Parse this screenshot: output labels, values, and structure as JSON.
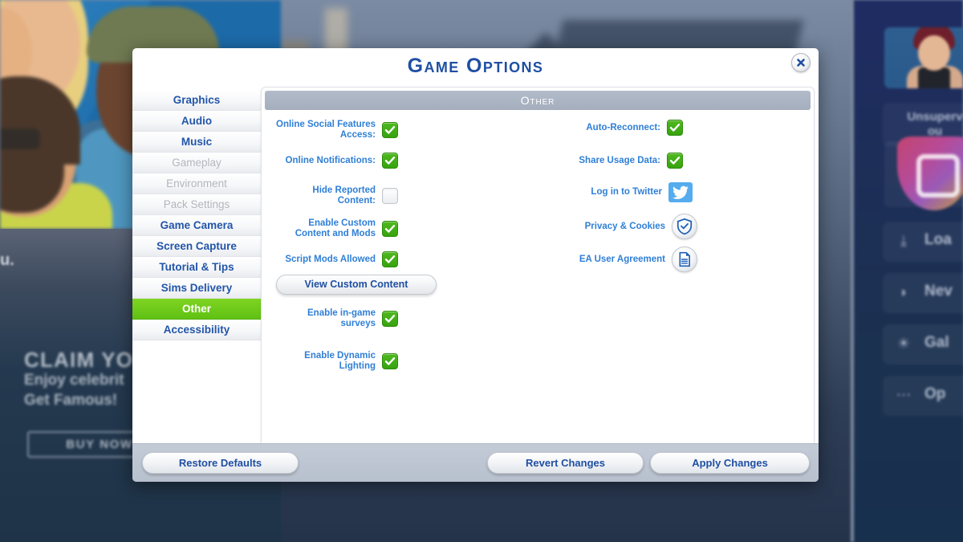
{
  "background": {
    "promo": {
      "ellipsis_text": "u.",
      "title": "CLAIM YO",
      "subtitle_line1": "Enjoy celebrit",
      "subtitle_line2": "Get Famous!",
      "buy_button": "BUY NOW"
    },
    "right_panel": {
      "status_line1": "Unsuperv",
      "status_line2": "ou",
      "items": [
        {
          "label": "Loa",
          "icon": "download-icon",
          "glyph": "⤓"
        },
        {
          "label": "Nev",
          "icon": "droplet-icon",
          "glyph": "◗"
        },
        {
          "label": "Gal",
          "icon": "lightbulb-icon",
          "glyph": "☀"
        },
        {
          "label": "Op",
          "icon": "ellipsis-icon",
          "glyph": "⋯"
        }
      ]
    }
  },
  "dialog": {
    "title": "Game Options",
    "close_icon": "close-icon",
    "sidebar": [
      {
        "label": "Graphics",
        "state": "normal"
      },
      {
        "label": "Audio",
        "state": "normal"
      },
      {
        "label": "Music",
        "state": "normal"
      },
      {
        "label": "Gameplay",
        "state": "disabled"
      },
      {
        "label": "Environment",
        "state": "disabled"
      },
      {
        "label": "Pack Settings",
        "state": "disabled"
      },
      {
        "label": "Game Camera",
        "state": "normal"
      },
      {
        "label": "Screen Capture",
        "state": "normal"
      },
      {
        "label": "Tutorial & Tips",
        "state": "normal"
      },
      {
        "label": "Sims Delivery",
        "state": "normal"
      },
      {
        "label": "Other",
        "state": "active"
      },
      {
        "label": "Accessibility",
        "state": "normal"
      }
    ],
    "section_header": "Other",
    "left_column": {
      "options": [
        {
          "label": "Online Social Features\nAccess:",
          "checked": true
        },
        {
          "label": "Online Notifications:",
          "checked": true
        },
        {
          "label": "Hide Reported\nContent:",
          "checked": false
        },
        {
          "label": "Enable Custom\nContent and Mods",
          "checked": true
        },
        {
          "label": "Script Mods Allowed",
          "checked": true
        },
        {
          "label": "Enable in-game\nsurveys",
          "checked": true
        },
        {
          "label": "Enable Dynamic\nLighting",
          "checked": true
        }
      ],
      "view_custom_content_button": "View Custom Content"
    },
    "right_column": {
      "options": [
        {
          "label": "Auto-Reconnect:",
          "checked": true
        },
        {
          "label": "Share Usage Data:",
          "checked": true
        }
      ],
      "links": [
        {
          "label": "Log in to Twitter",
          "icon": "twitter-icon"
        },
        {
          "label": "Privacy & Cookies",
          "icon": "shield-check-icon"
        },
        {
          "label": "EA User Agreement",
          "icon": "document-icon"
        }
      ]
    },
    "footer": {
      "restore_defaults": "Restore Defaults",
      "revert_changes": "Revert Changes",
      "apply_changes": "Apply Changes"
    }
  },
  "colors": {
    "accent_blue": "#1f4fa3",
    "label_blue": "#2f7fd6",
    "active_green": "#5fc113",
    "check_green": "#37a30f",
    "twitter_blue": "#55acee",
    "section_gray": "#a4aebd"
  }
}
